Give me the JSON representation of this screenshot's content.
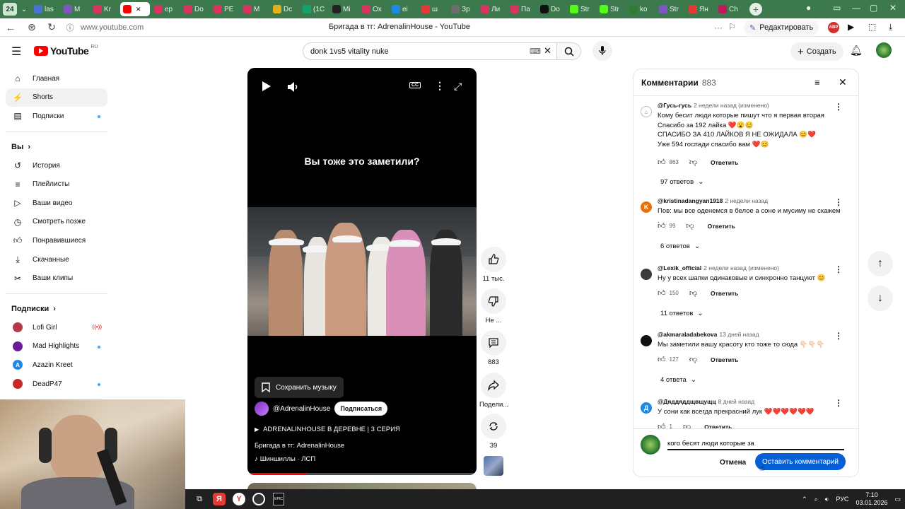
{
  "browser": {
    "tab_count": "24",
    "tabs": [
      {
        "label": "las",
        "color": "#4a72d6"
      },
      {
        "label": "M",
        "color": "#7e57c2"
      },
      {
        "label": "Kr",
        "color": "#d8345f"
      },
      {
        "label": "",
        "color": "#ff0000",
        "active": true
      },
      {
        "label": "ep",
        "color": "#d8345f"
      },
      {
        "label": "Do",
        "color": "#d8345f"
      },
      {
        "label": "PE",
        "color": "#d8345f"
      },
      {
        "label": "M",
        "color": "#d8345f"
      },
      {
        "label": "Dc",
        "color": "#e3b21b"
      },
      {
        "label": "(1С",
        "color": "#14a36c"
      },
      {
        "label": "Mi",
        "color": "#222222"
      },
      {
        "label": "Ox",
        "color": "#d8345f"
      },
      {
        "label": "ei",
        "color": "#1e88e5"
      },
      {
        "label": "ш",
        "color": "#e53935"
      },
      {
        "label": "Зр",
        "color": "#6d6d6d"
      },
      {
        "label": "Ли",
        "color": "#d8345f"
      },
      {
        "label": "Па",
        "color": "#d8345f"
      },
      {
        "label": "Do",
        "color": "#111111"
      },
      {
        "label": "Str",
        "color": "#53fc18"
      },
      {
        "label": "Str",
        "color": "#53fc18"
      },
      {
        "label": "ko",
        "color": "#2e7d32"
      },
      {
        "label": "Str",
        "color": "#7e57c2"
      },
      {
        "label": "Ян",
        "color": "#e53935"
      },
      {
        "label": "Ch",
        "color": "#c2185b"
      }
    ],
    "url": "www.youtube.com",
    "page_title": "Бригада в тг: AdrenalinHouse - YouTube",
    "edit_label": "Редактировать",
    "abp_label": "ABP"
  },
  "header": {
    "logo_text": "YouTube",
    "logo_region": "RU",
    "search_value": "donk 1vs5 vitality nuke",
    "create_label": "Создать"
  },
  "sidebar": {
    "main": [
      {
        "label": "Главная",
        "icon": "home-icon"
      },
      {
        "label": "Shorts",
        "icon": "shorts-icon",
        "active": true
      },
      {
        "label": "Подписки",
        "icon": "subscriptions-icon",
        "dot": true
      }
    ],
    "you_header": "Вы",
    "you": [
      {
        "label": "История",
        "icon": "history-icon"
      },
      {
        "label": "Плейлисты",
        "icon": "playlists-icon"
      },
      {
        "label": "Ваши видео",
        "icon": "your-videos-icon"
      },
      {
        "label": "Смотреть позже",
        "icon": "watch-later-icon"
      },
      {
        "label": "Понравившиеся",
        "icon": "liked-icon"
      },
      {
        "label": "Скачанные",
        "icon": "downloads-icon"
      },
      {
        "label": "Ваши клипы",
        "icon": "clips-icon"
      }
    ],
    "subs_header": "Подписки",
    "subs": [
      {
        "label": "Lofi Girl",
        "color": "#b23a48",
        "live": true
      },
      {
        "label": "Mad Highlights",
        "color": "#6a1b9a",
        "dot": true
      },
      {
        "label": "Azazin Kreet",
        "color": "#1e88e5",
        "initial": "A"
      },
      {
        "label": "DeadP47",
        "color": "#c62828",
        "dot": true
      }
    ]
  },
  "short": {
    "caption": "Вы тоже это заметили?",
    "save_music": "Сохранить музыку",
    "channel": "@AdrenalinHouse",
    "subscribe": "Подписаться",
    "playlist": "ADRENALINHOUSE В ДЕРЕВНЕ | 3 СЕРИЯ",
    "title": "Бригада в тг: AdrenalinHouse",
    "sound": "Шиншиллы · ЛСП",
    "progress_pct": 26
  },
  "actions": {
    "likes": "11 тыс.",
    "dislike": "Не ...",
    "comments": "883",
    "share": "Подели...",
    "remix": "39"
  },
  "comments": {
    "title": "Комментарии",
    "count": "883",
    "items": [
      {
        "author": "@Гусь-гусь",
        "time": "2 недели назад (изменено)",
        "avatar_color": "#ffffff",
        "avatar_initial": "",
        "text": "Кому бесит люди которые пишут что я первая вторая\nСпасибо за 192 лайка ❤️😮😊\nСПАСИБО ЗА 410 ЛАЙКОВ Я НЕ ОЖИДАЛА 😊❤️\nУже 594 госпади спасибо вам ❤️😊",
        "likes": "863",
        "reply": "Ответить",
        "replies": "97 ответов"
      },
      {
        "author": "@kristinadangyan1918",
        "time": "2 недели назад",
        "avatar_color": "#e8710a",
        "avatar_initial": "K",
        "text": "Пов: мы все оденемся в белое а соне и мусиму  не скажем .",
        "likes": "99",
        "reply": "Ответить",
        "replies": "6 ответов"
      },
      {
        "author": "@Lexik_official",
        "time": "2 недели назад (изменено)",
        "avatar_color": "#3a3a3a",
        "avatar_initial": "",
        "text": "Ну у всех шапки одинаковые и синхронно танцуют 😊",
        "likes": "150",
        "reply": "Ответить",
        "replies": "11 ответов"
      },
      {
        "author": "@akmaraladabekova",
        "time": "13 дней назад",
        "avatar_color": "#111111",
        "avatar_initial": "",
        "text": "Мы заметили вашу красоту кто тоже то сюда 👇🏻👇🏻👇🏻",
        "likes": "127",
        "reply": "Ответить",
        "replies": "4 ответа"
      },
      {
        "author": "@Дяддяддщвщущц",
        "time": "8 дней назад",
        "avatar_color": "#1e88e5",
        "avatar_initial": "Д",
        "text": "У сони как всегда прекрасний лук ❤️❤️❤️❤️❤️❤️",
        "likes": "1",
        "reply": "Ответить",
        "replies": ""
      }
    ],
    "compose_value": "кого бесят люди которые за",
    "cancel": "Отмена",
    "submit": "Оставить комментарий"
  },
  "taskbar": {
    "lang": "РУС",
    "time": "7:10",
    "date": "03.01.2026"
  }
}
